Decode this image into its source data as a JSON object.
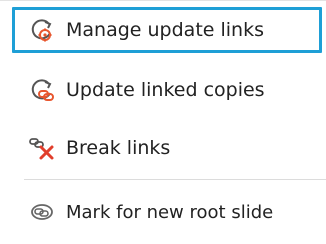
{
  "menu": {
    "items": [
      {
        "label": "Manage update links",
        "icon": "manage-links-icon",
        "state": "focused"
      },
      {
        "label": "Update linked copies",
        "icon": "update-copies-icon"
      },
      {
        "label": "Break links",
        "icon": "break-links-icon"
      },
      {
        "label": "Mark for new root slide",
        "icon": "mark-root-icon"
      }
    ]
  },
  "colors": {
    "focus_border": "#1e9fd6",
    "icon_accent": "#e8572f",
    "break_accent": "#e13e2b",
    "icon_gray": "#555555"
  }
}
